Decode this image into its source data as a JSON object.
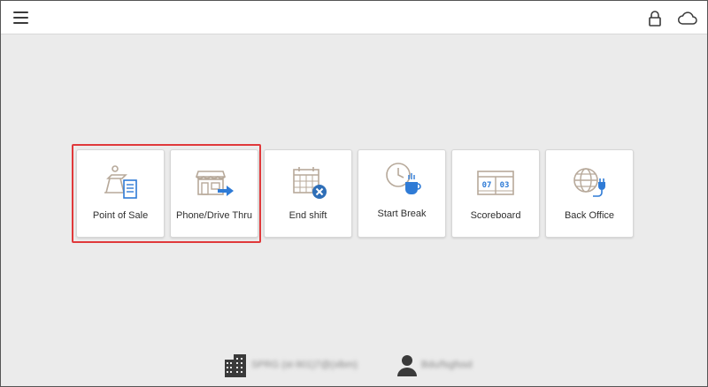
{
  "topbar": {
    "menu_icon": "hamburger-menu-icon",
    "lock_icon": "lock-icon",
    "cloud_icon": "cloud-icon"
  },
  "tiles": [
    {
      "label": "Point of Sale",
      "icon": "pos-register-receipt-icon"
    },
    {
      "label": "Phone/Drive Thru",
      "icon": "storefront-arrow-icon"
    },
    {
      "label": "End shift",
      "icon": "calendar-close-icon"
    },
    {
      "label": "Start Break",
      "icon": "clock-coffee-icon"
    },
    {
      "label": "Scoreboard",
      "icon": "scoreboard-icon"
    },
    {
      "label": "Back Office",
      "icon": "globe-plug-icon"
    }
  ],
  "scoreboard_digits": [
    "07",
    "03"
  ],
  "footer": {
    "store_icon": "building-icon",
    "store_text": "SPRG (st-901)7@(xlbm)",
    "user_icon": "user-icon",
    "user_text": "Bdu/fsgfssd"
  },
  "colors": {
    "highlight": "#e0393b",
    "accent_blue": "#2f7bd6",
    "icon_tan": "#b7a99a"
  }
}
